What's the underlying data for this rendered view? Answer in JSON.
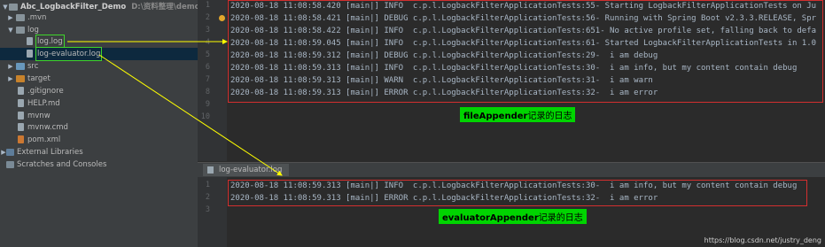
{
  "project_tree": {
    "items": [
      {
        "label": "Abc_LogbackFilter_Demo",
        "path": "D:\\资料整理\\demo模板\\",
        "type": "project-root",
        "expanded": true
      },
      {
        "label": ".mvn",
        "type": "folder",
        "expanded": false
      },
      {
        "label": "log",
        "type": "folder",
        "expanded": true
      },
      {
        "label": "log.log",
        "type": "file"
      },
      {
        "label": "log-evaluator.log",
        "type": "file",
        "selected": true
      },
      {
        "label": "src",
        "type": "folder-blue",
        "expanded": false
      },
      {
        "label": "target",
        "type": "folder-orange",
        "expanded": false
      },
      {
        "label": ".gitignore",
        "type": "file"
      },
      {
        "label": "HELP.md",
        "type": "file"
      },
      {
        "label": "mvnw",
        "type": "file"
      },
      {
        "label": "mvnw.cmd",
        "type": "file"
      },
      {
        "label": "pom.xml",
        "type": "file"
      },
      {
        "label": "External Libraries",
        "type": "library",
        "expanded": false
      },
      {
        "label": "Scratches and Consoles",
        "type": "scratches"
      }
    ]
  },
  "editor_top": {
    "line_numbers": [
      "1",
      "2",
      "3",
      "4",
      "5",
      "6",
      "7",
      "8",
      "9",
      "10"
    ],
    "lines": [
      "2020-08-18 11:08:58.420 [main|] INFO  c.p.l.LogbackFilterApplicationTests:55- Starting LogbackFilterApplicationTests on Ju",
      "2020-08-18 11:08:58.421 [main|] DEBUG c.p.l.LogbackFilterApplicationTests:56- Running with Spring Boot v2.3.3.RELEASE, Spr",
      "2020-08-18 11:08:58.422 [main|] INFO  c.p.l.LogbackFilterApplicationTests:651- No active profile set, falling back to defa",
      "2020-08-18 11:08:59.045 [main|] INFO  c.p.l.LogbackFilterApplicationTests:61- Started LogbackFilterApplicationTests in 1.0",
      "2020-08-18 11:08:59.312 [main|] DEBUG c.p.l.LogbackFilterApplicationTests:29-  i am debug",
      "2020-08-18 11:08:59.313 [main|] INFO  c.p.l.LogbackFilterApplicationTests:30-  i am info, but my content contain debug",
      "2020-08-18 11:08:59.313 [main|] WARN  c.p.l.LogbackFilterApplicationTests:31-  i am warn",
      "2020-08-18 11:08:59.313 [main|] ERROR c.p.l.LogbackFilterApplicationTests:32-  i am error"
    ],
    "annotation": {
      "bold": "fileAppender",
      "rest": "记录的日志"
    }
  },
  "editor_bottom": {
    "tab_label": "log-evaluator.log",
    "line_numbers": [
      "1",
      "2",
      "3"
    ],
    "lines": [
      "2020-08-18 11:08:59.313 [main|] INFO  c.p.l.LogbackFilterApplicationTests:30-  i am info, but my content contain debug",
      "2020-08-18 11:08:59.313 [main|] ERROR c.p.l.LogbackFilterApplicationTests:32-  i am error"
    ],
    "annotation": {
      "bold": "evaluatorAppender",
      "rest": "记录的日志"
    }
  },
  "watermark": "https://blog.csdn.net/justry_deng",
  "colors": {
    "highlight_green": "#00d400",
    "arrow_yellow": "#ffff00",
    "box_red": "#d32f2f"
  }
}
